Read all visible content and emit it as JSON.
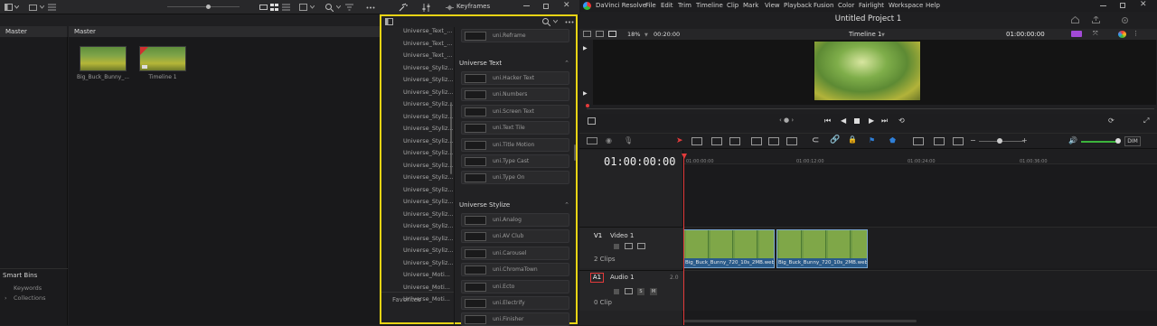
{
  "left_panel": {
    "tabs": {
      "master_left": "Master",
      "master_right": "Master"
    },
    "media": [
      {
        "name": "Big_Buck_Bunny_..."
      },
      {
        "name": "Timeline 1"
      }
    ],
    "smart_bins": {
      "title": "Smart Bins",
      "items": [
        "Keywords",
        "Collections"
      ]
    }
  },
  "effects_panel": {
    "keyframes_label": "Keyframes",
    "tree_items": [
      "Universe_Text_...",
      "Universe_Text_...",
      "Universe_Text_...",
      "Universe_Styliz...",
      "Universe_Styliz...",
      "Universe_Styliz...",
      "Universe_Styliz...",
      "Universe_Styliz...",
      "Universe_Styliz...",
      "Universe_Styliz...",
      "Universe_Styliz...",
      "Universe_Styliz...",
      "Universe_Styliz...",
      "Universe_Styliz...",
      "Universe_Styliz...",
      "Universe_Styliz...",
      "Universe_Styliz...",
      "Universe_Styliz...",
      "Universe_Styliz...",
      "Universe_Styliz...",
      "Universe_Moti...",
      "Universe_Moti...",
      "Universe_Moti..."
    ],
    "favorites": "Favorites",
    "groups": [
      {
        "title": "",
        "items": [
          "uni.Reframe"
        ]
      },
      {
        "title": "Universe Text",
        "items": [
          "uni.Hacker Text",
          "uni.Numbers",
          "uni.Screen Text",
          "uni.Text Tile",
          "uni.Title Motion",
          "uni.Type Cast",
          "uni.Type On"
        ]
      },
      {
        "title": "Universe Stylize",
        "items": [
          "uni.Analog",
          "uni.AV Club",
          "uni.Carousel",
          "uni.ChromaTown",
          "uni.Ecto",
          "uni.Electrify",
          "uni.Finisher"
        ]
      }
    ]
  },
  "app": {
    "name": "DaVinci Resolve",
    "menu": [
      "File",
      "Edit",
      "Trim",
      "Timeline",
      "Clip",
      "Mark",
      "View",
      "Playback",
      "Fusion",
      "Color",
      "Fairlight",
      "Workspace",
      "Help"
    ],
    "project_title": "Untitled Project 1"
  },
  "viewer": {
    "zoom": "18%",
    "duration": "00:20:00",
    "timeline_name": "Timeline 1",
    "timecode": "01:00:00:00"
  },
  "timeline": {
    "current_timecode": "01:00:00:00",
    "ruler": [
      "01:00:00:00",
      "01:00:12:00",
      "01:00:24:00",
      "01:00:36:00"
    ],
    "dim_label": "DIM",
    "tracks": [
      {
        "id": "V1",
        "name": "Video 1",
        "info": "2 Clips"
      },
      {
        "id": "A1",
        "name": "Audio 1",
        "info": "0 Clip",
        "channels": "2.0"
      }
    ],
    "clips": [
      "Big_Buck_Bunny_720_10s_2MB.webm",
      "Big_Buck_Bunny_720_10s_2MB.webm"
    ]
  },
  "colors": {
    "highlight": "#e8d414",
    "playhead": "#e23b3b",
    "clip": "#2a5b8a",
    "accent": "#2f7fd8"
  }
}
